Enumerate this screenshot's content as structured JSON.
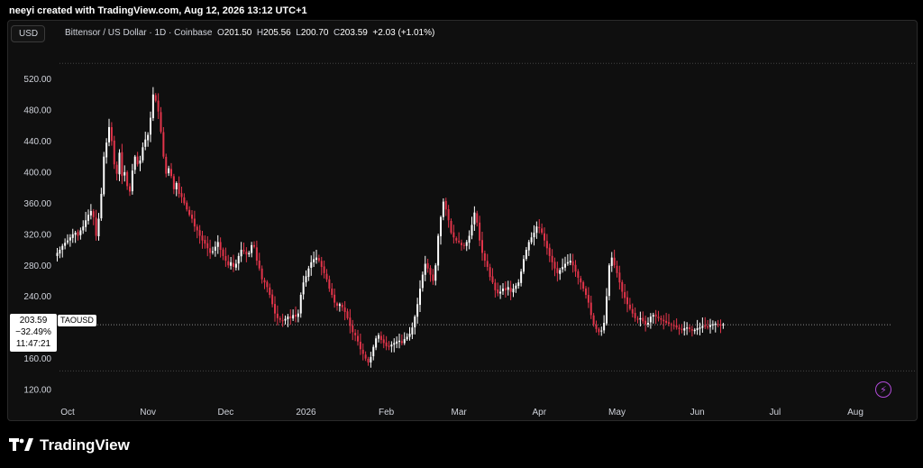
{
  "header": {
    "credit": "neeyi created with TradingView.com, Aug 12, 2026 13:12 UTC+1"
  },
  "toolbar": {
    "currency": "USD"
  },
  "legend": {
    "symbol_desc": "Bittensor / US Dollar · 1D · Coinbase",
    "open_label": "O",
    "open": "201.50",
    "high_label": "H",
    "high": "205.56",
    "low_label": "L",
    "low": "200.70",
    "close_label": "C",
    "close": "203.59",
    "change": "+2.03 (+1.01%)"
  },
  "price_tag": {
    "price": "203.59",
    "pct": "−32.49%",
    "countdown": "11:47:21",
    "symbol": "TAOUSD"
  },
  "brand": {
    "name": "TradingView"
  },
  "colors": {
    "up": "#ffffff",
    "down": "#e2344a",
    "grid": "#444444",
    "bg": "#0f0f0f",
    "accent": "#b24bd9"
  },
  "icons": {
    "bolt": "lightning-icon",
    "logo": "tradingview-logo-icon"
  },
  "chart_data": {
    "type": "candlestick",
    "title": "Bittensor / US Dollar · 1D · Coinbase",
    "y_axis": {
      "ylim": [
        105,
        545
      ],
      "ticks": [
        120,
        160,
        200,
        240,
        280,
        320,
        360,
        400,
        440,
        480,
        520
      ],
      "tick_labels": [
        "120.00",
        "160.00",
        "200.00",
        "240.00",
        "280.00",
        "320.00",
        "360.00",
        "400.00",
        "440.00",
        "480.00",
        "520.00"
      ],
      "position": "left"
    },
    "x_axis": {
      "labels": [
        "Oct",
        "Nov",
        "Dec",
        "2026",
        "Feb",
        "Mar",
        "Apr",
        "May",
        "Jun",
        "Jul",
        "Aug"
      ],
      "label_day_index": [
        0,
        31,
        61,
        92,
        123,
        151,
        182,
        212,
        243,
        273,
        304
      ]
    },
    "start_day_index": -4,
    "days_per_candle": 1,
    "close_series": [
      296,
      300,
      305,
      309,
      312,
      316,
      320,
      322,
      318,
      325,
      330,
      338,
      345,
      350,
      342,
      318,
      340,
      372,
      420,
      438,
      458,
      440,
      410,
      398,
      425,
      395,
      400,
      382,
      375,
      402,
      420,
      410,
      415,
      432,
      442,
      448,
      470,
      500,
      492,
      478,
      452,
      420,
      398,
      405,
      395,
      378,
      386,
      372,
      368,
      360,
      352,
      345,
      340,
      330,
      325,
      318,
      312,
      308,
      302,
      296,
      298,
      304,
      310,
      300,
      292,
      286,
      280,
      284,
      278,
      282,
      292,
      300,
      298,
      294,
      296,
      306,
      304,
      286,
      276,
      262,
      258,
      252,
      242,
      230,
      218,
      212,
      210,
      208,
      211,
      214,
      212,
      216,
      214,
      218,
      242,
      258,
      266,
      276,
      284,
      288,
      290,
      286,
      278,
      270,
      262,
      250,
      242,
      232,
      228,
      230,
      226,
      220,
      212,
      202,
      194,
      190,
      182,
      172,
      166,
      160,
      155,
      162,
      175,
      186,
      190,
      184,
      180,
      176,
      175,
      178,
      180,
      182,
      183,
      180,
      185,
      188,
      192,
      200,
      214,
      230,
      250,
      268,
      282,
      276,
      268,
      260,
      280,
      318,
      342,
      362,
      352,
      338,
      322,
      316,
      312,
      310,
      306,
      305,
      310,
      318,
      332,
      348,
      335,
      312,
      296,
      286,
      278,
      265,
      258,
      248,
      244,
      246,
      250,
      248,
      252,
      246,
      250,
      254,
      258,
      272,
      288,
      300,
      310,
      316,
      322,
      330,
      328,
      322,
      312,
      302,
      292,
      284,
      276,
      270,
      274,
      278,
      282,
      284,
      286,
      280,
      272,
      264,
      258,
      250,
      242,
      232,
      216,
      204,
      198,
      194,
      196,
      206,
      240,
      280,
      290,
      280,
      270,
      258,
      246,
      238,
      230,
      224,
      218,
      212,
      210,
      212,
      208,
      204,
      206,
      214,
      216,
      214,
      212,
      210,
      208,
      206,
      205,
      204,
      202,
      200,
      198,
      197,
      199,
      200,
      198,
      196,
      197,
      199,
      200,
      202,
      201,
      200,
      203,
      204,
      205,
      204,
      203,
      204
    ],
    "series": [
      {
        "name": "TAOUSD",
        "last": 203.59,
        "change_pct_marker": -32.49
      }
    ]
  }
}
